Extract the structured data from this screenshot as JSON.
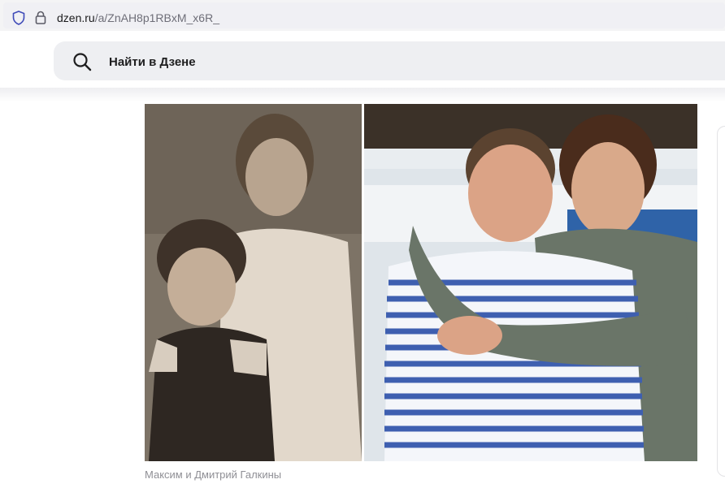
{
  "browser": {
    "url_domain": "dzen.ru",
    "url_path": "/a/ZnAH8p1RBxM_x6R_",
    "icons": [
      "shield-icon",
      "lock-icon"
    ]
  },
  "header": {
    "search_label": "Найти в Дзене",
    "search_icon": "search-icon"
  },
  "article": {
    "image_caption": "Максим и Дмитрий Галкины"
  }
}
